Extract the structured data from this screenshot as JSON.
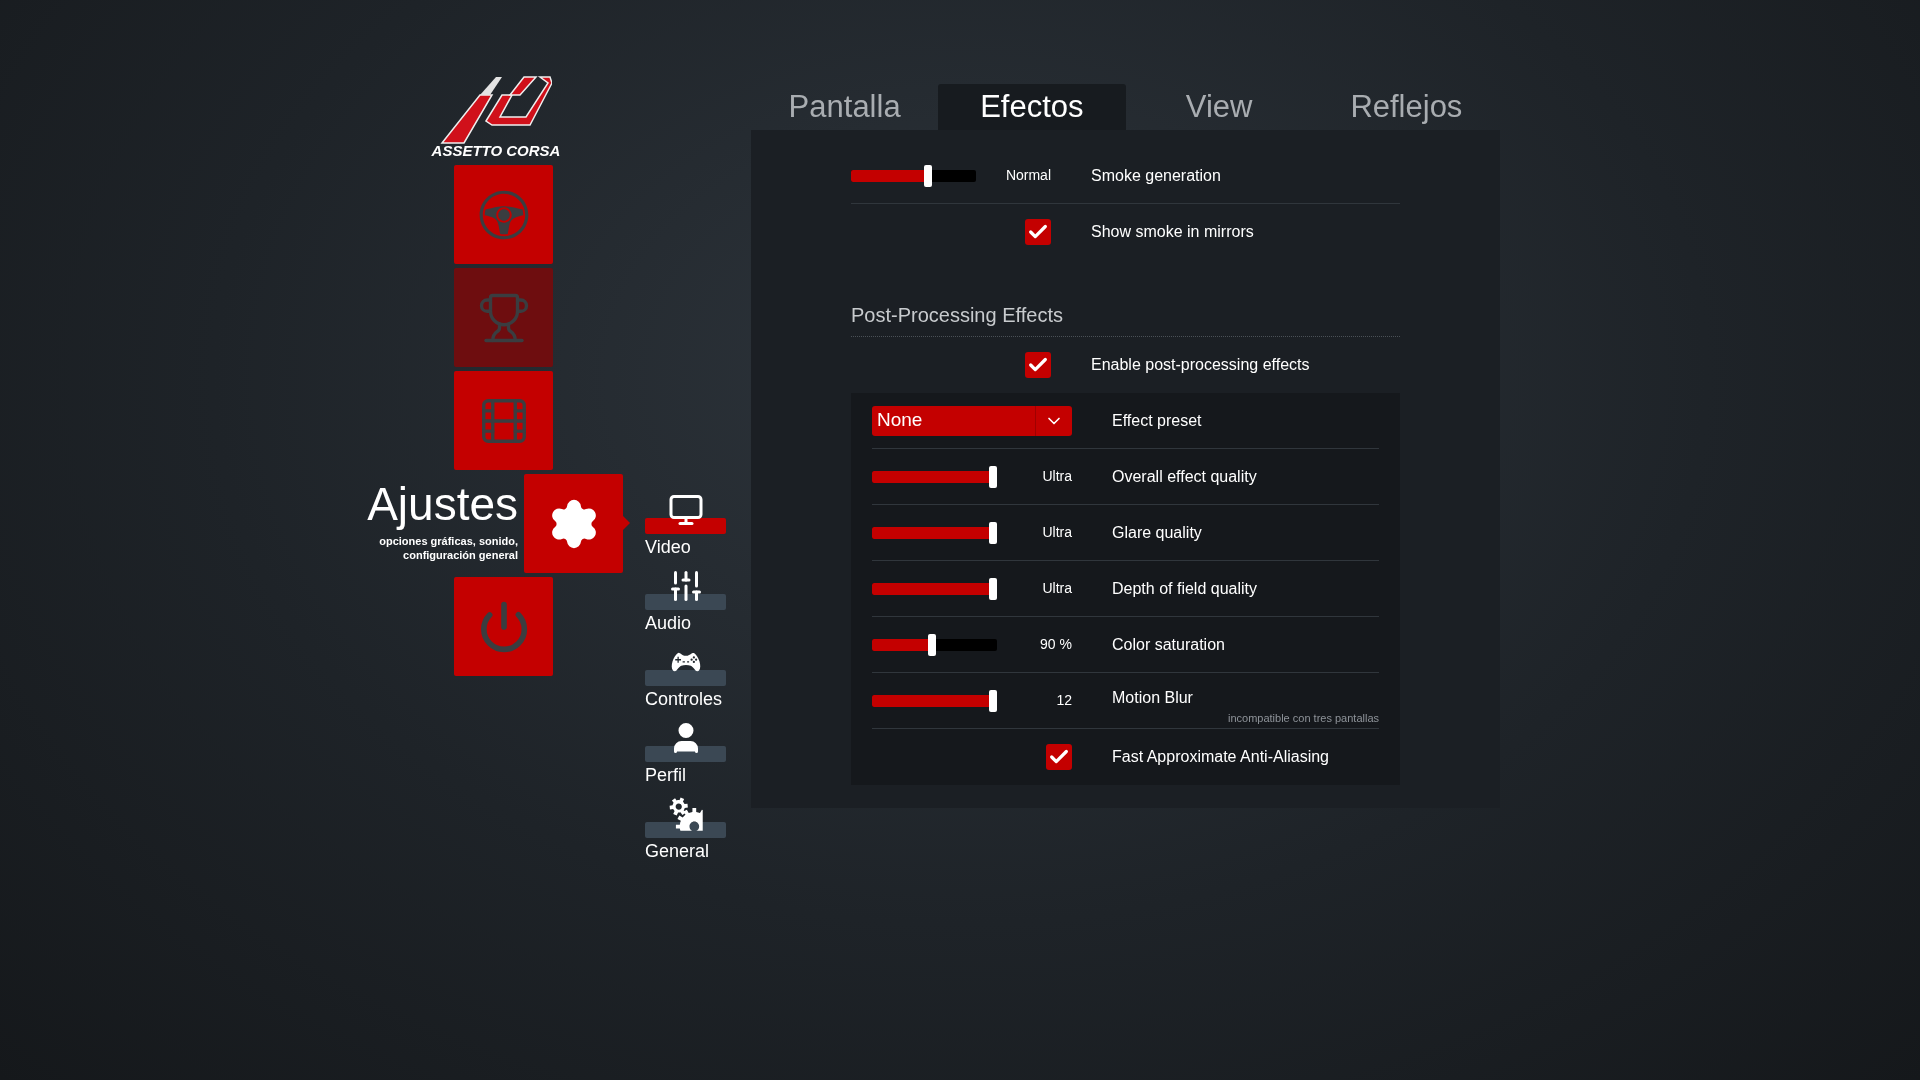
{
  "logo": {
    "text": "ASSETTO CORSA"
  },
  "main_menu": [
    {
      "selected": false,
      "disabled": false
    },
    {
      "selected": false,
      "disabled": true
    },
    {
      "selected": false,
      "disabled": false
    },
    {
      "selected": true,
      "disabled": false,
      "title": "Ajustes",
      "subtitle": "opciones gráficas, sonido, configuración general"
    },
    {
      "selected": false,
      "disabled": false
    }
  ],
  "sub_menu": [
    {
      "label": "Video",
      "selected": true
    },
    {
      "label": "Audio",
      "selected": false
    },
    {
      "label": "Controles",
      "selected": false
    },
    {
      "label": "Perfil",
      "selected": false
    },
    {
      "label": "General",
      "selected": false
    }
  ],
  "tabs": [
    {
      "label": "Pantalla",
      "selected": false
    },
    {
      "label": "Efectos",
      "selected": true
    },
    {
      "label": "View",
      "selected": false
    },
    {
      "label": "Reflejos",
      "selected": false
    }
  ],
  "settings": [
    {
      "kind": "slider",
      "label": "Smoke generation",
      "reading": "Normal",
      "level": 0.62
    },
    {
      "kind": "checkbox",
      "label": "Show smoke in mirrors",
      "checked": true
    }
  ],
  "post_processing": {
    "title": "Post-Processing Effects",
    "settings": [
      {
        "kind": "checkbox",
        "label": "Enable post-processing effects",
        "checked": true
      }
    ],
    "group": [
      {
        "kind": "dropdown",
        "label": "Effect preset",
        "value": "None"
      },
      {
        "kind": "slider",
        "label": "Overall effect quality",
        "reading": "Ultra",
        "level": 1
      },
      {
        "kind": "slider",
        "label": "Glare quality",
        "reading": "Ultra",
        "level": 1
      },
      {
        "kind": "slider",
        "label": "Depth of field quality",
        "reading": "Ultra",
        "level": 1
      },
      {
        "kind": "slider",
        "label": "Color saturation",
        "reading": "90 %",
        "level": 0.48
      },
      {
        "kind": "slider",
        "label": "Motion Blur",
        "reading": "12",
        "level": 1,
        "note": "incompatible con tres pantallas"
      },
      {
        "kind": "checkbox",
        "label": "Fast Approximate Anti-Aliasing",
        "checked": true
      }
    ]
  }
}
